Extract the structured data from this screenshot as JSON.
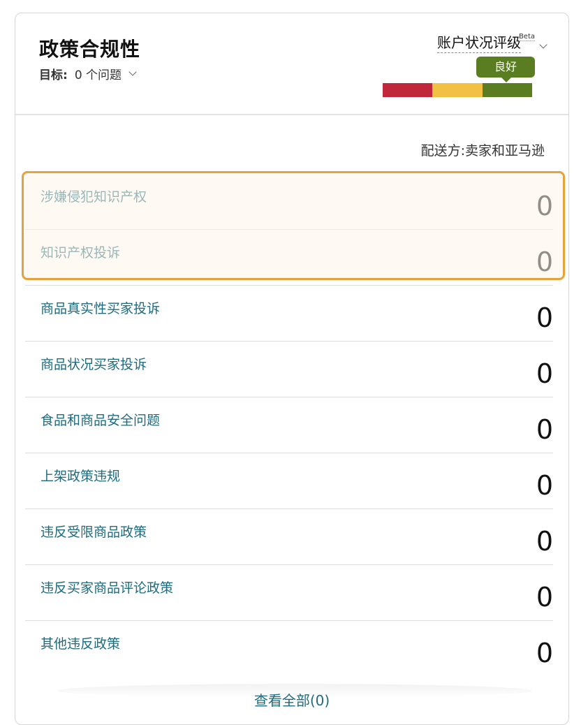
{
  "header": {
    "title": "政策合规性",
    "target_label": "目标:",
    "target_value": "0 个问题"
  },
  "rating": {
    "title": "账户状况评级",
    "beta": "Beta",
    "status": "良好",
    "colors": {
      "bad": "#c0273b",
      "fair": "#f2c144",
      "good": "#5b7d22"
    }
  },
  "fulfillment": "配送方:卖家和亚马逊",
  "items": [
    {
      "label": "涉嫌侵犯知识产权",
      "count": "0"
    },
    {
      "label": "知识产权投诉",
      "count": "0"
    },
    {
      "label": "商品真实性买家投诉",
      "count": "0"
    },
    {
      "label": "商品状况买家投诉",
      "count": "0"
    },
    {
      "label": "食品和商品安全问题",
      "count": "0"
    },
    {
      "label": "上架政策违规",
      "count": "0"
    },
    {
      "label": "违反受限商品政策",
      "count": "0"
    },
    {
      "label": "违反买家商品评论政策",
      "count": "0"
    },
    {
      "label": "其他违反政策",
      "count": "0"
    }
  ],
  "footer": {
    "view_all": "查看全部(0)"
  }
}
